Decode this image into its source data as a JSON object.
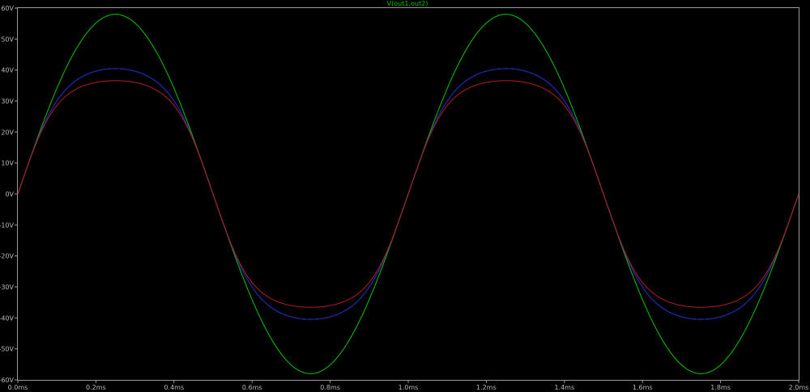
{
  "chart_data": {
    "type": "line",
    "title": "V(out1,out2)",
    "xlabel": "",
    "ylabel": "",
    "xlim": [
      0,
      2.0
    ],
    "ylim": [
      -60,
      60
    ],
    "x_ticks": [
      0.0,
      0.2,
      0.4,
      0.6,
      0.8,
      1.0,
      1.2,
      1.4,
      1.6,
      1.8,
      2.0
    ],
    "x_tick_labels": [
      "0.0ms",
      "0.2ms",
      "0.4ms",
      "0.6ms",
      "0.8ms",
      "1.0ms",
      "1.2ms",
      "1.4ms",
      "1.6ms",
      "1.8ms",
      "2.0ms"
    ],
    "y_ticks": [
      60,
      50,
      40,
      30,
      20,
      10,
      0,
      -10,
      -20,
      -30,
      -40,
      -50,
      -60
    ],
    "y_tick_labels": [
      "60V",
      "50V",
      "40V",
      "30V",
      "20V",
      "10V",
      "0V",
      "-10V",
      "-20V",
      "-30V",
      "-40V",
      "-50V",
      "-60V"
    ],
    "grid": false,
    "frequency_khz": 1.0,
    "series": [
      {
        "color": "#00c800",
        "amplitude": 58,
        "clip_level": 58
      },
      {
        "color": "#5aa8d8",
        "amplitude": 58,
        "clip_level": 49
      },
      {
        "color": "#1a1ab4",
        "amplitude": 58,
        "clip_level": 49
      },
      {
        "color": "#b41e1e",
        "amplitude": 58,
        "clip_level": 42
      }
    ],
    "colors": {
      "background": "#000000",
      "frame": "#9a9a9a",
      "tick_text": "#b8b8b8",
      "title": "#00c800"
    }
  }
}
